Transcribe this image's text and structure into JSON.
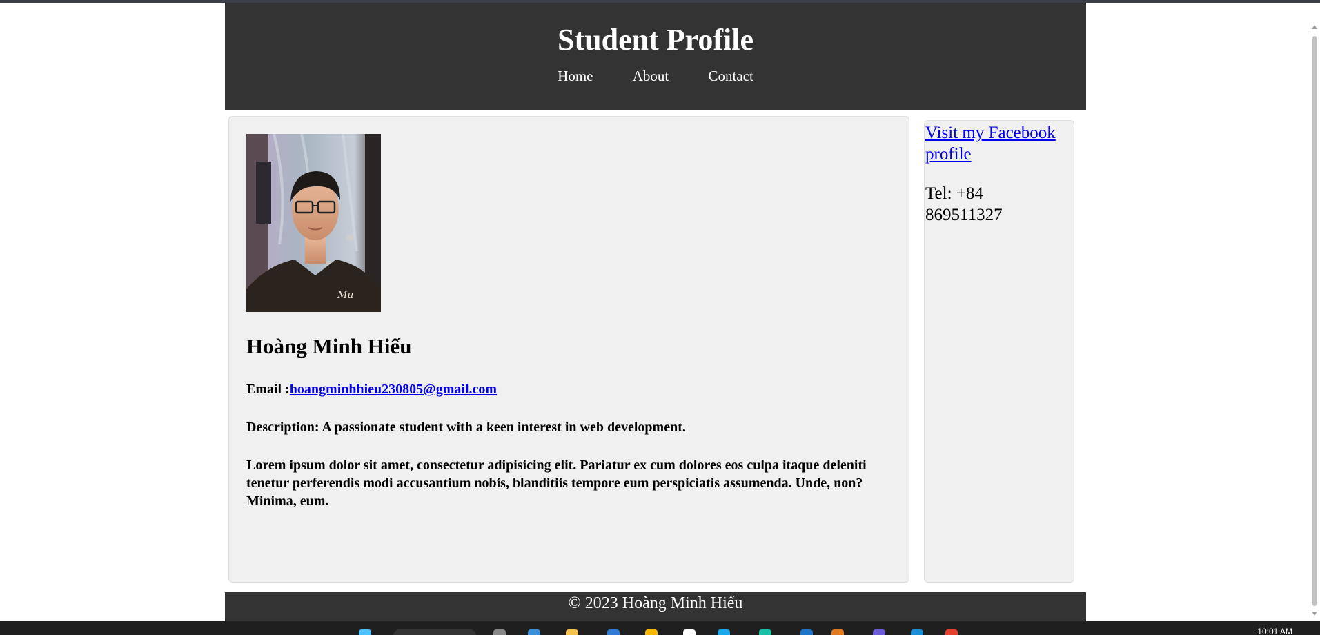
{
  "header": {
    "title": "Student Profile",
    "nav": [
      "Home",
      "About",
      "Contact"
    ]
  },
  "profile": {
    "name": "Hoàng Minh Hiếu",
    "email_label": "Email :",
    "email": "hoangminhhieu230805@gmail.com",
    "description": "Description: A passionate student with a keen interest in web development.",
    "lorem": "Lorem ipsum dolor sit amet, consectetur adipisicing elit. Pariatur ex cum dolores eos culpa itaque deleniti tenetur perferendis modi accusantium nobis, blanditiis tempore eum perspiciatis assumenda. Unde, non? Minima, eum."
  },
  "sidebar": {
    "facebook_link": "Visit my Facebook profile",
    "tel": "Tel: +84 869511327"
  },
  "footer": {
    "text": "© 2023 Hoàng Minh Hiếu"
  },
  "taskbar": {
    "clock": "10:01 AM"
  },
  "colors": {
    "header_bg": "#333333",
    "card_bg": "#f0f0f0",
    "link": "#0000ee"
  }
}
